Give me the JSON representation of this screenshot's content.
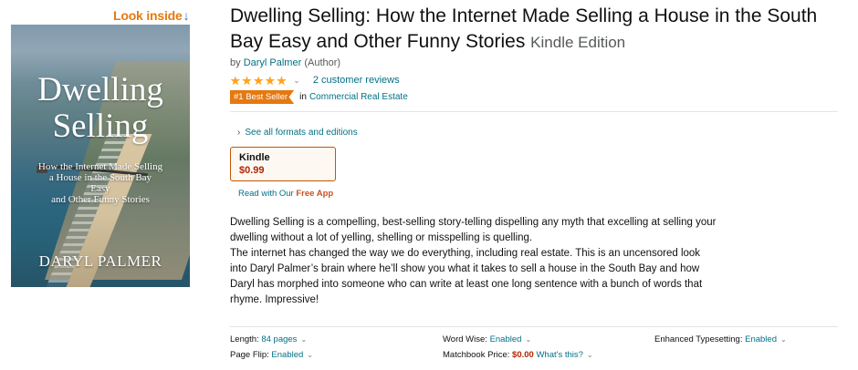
{
  "look_inside": {
    "label": "Look inside",
    "arrow": "↓"
  },
  "cover": {
    "title_line1": "Dwelling",
    "title_line2": "Selling",
    "subtitle_lines": [
      "How the Internet Made Selling",
      "a House in the South Bay",
      "Easy",
      "and Other Funny Stories"
    ],
    "author": "DARYL PALMER"
  },
  "product": {
    "title": "Dwelling Selling: How the Internet Made Selling a House in the South Bay Easy and Other Funny Stories",
    "edition": "Kindle Edition",
    "byline_prefix": "by",
    "author": "Daryl Palmer",
    "author_role": "(Author)"
  },
  "ratings": {
    "stars": 5,
    "reviews_label": "2 customer reviews"
  },
  "best_seller": {
    "badge": "#1 Best Seller",
    "in_label": "in",
    "category": "Commercial Real Estate"
  },
  "formats": {
    "link": "See all formats and editions"
  },
  "format_box": {
    "label": "Kindle",
    "price": "$0.99"
  },
  "free_app": {
    "prefix": "Read with Our",
    "bold": "Free App"
  },
  "description": {
    "lines": [
      "Dwelling Selling is a compelling, best-selling story-telling dispelling any myth that excelling at selling your",
      "dwelling without a lot of yelling, shelling or misspelling is quelling.",
      "The internet has changed the way we do everything, including real estate. This is an uncensored look",
      "into Daryl Palmer’s brain where he’ll show you what it takes to sell a house in the South Bay and how",
      "Daryl has morphed into someone who can write at least one long sentence with a bunch of words that",
      "rhyme. Impressive!"
    ]
  },
  "details": {
    "length_label": "Length:",
    "length_value": "84 pages",
    "wordwise_label": "Word Wise:",
    "wordwise_value": "Enabled",
    "typesetting_label": "Enhanced Typesetting:",
    "typesetting_value": "Enabled",
    "pageflip_label": "Page Flip:",
    "pageflip_value": "Enabled",
    "matchbook_label": "Matchbook Price:",
    "matchbook_price": "$0.00",
    "matchbook_link": "What's this?"
  },
  "colors": {
    "accent_orange": "#E47911",
    "link": "#007185",
    "price": "#B12704",
    "star": "#FFA41C"
  }
}
